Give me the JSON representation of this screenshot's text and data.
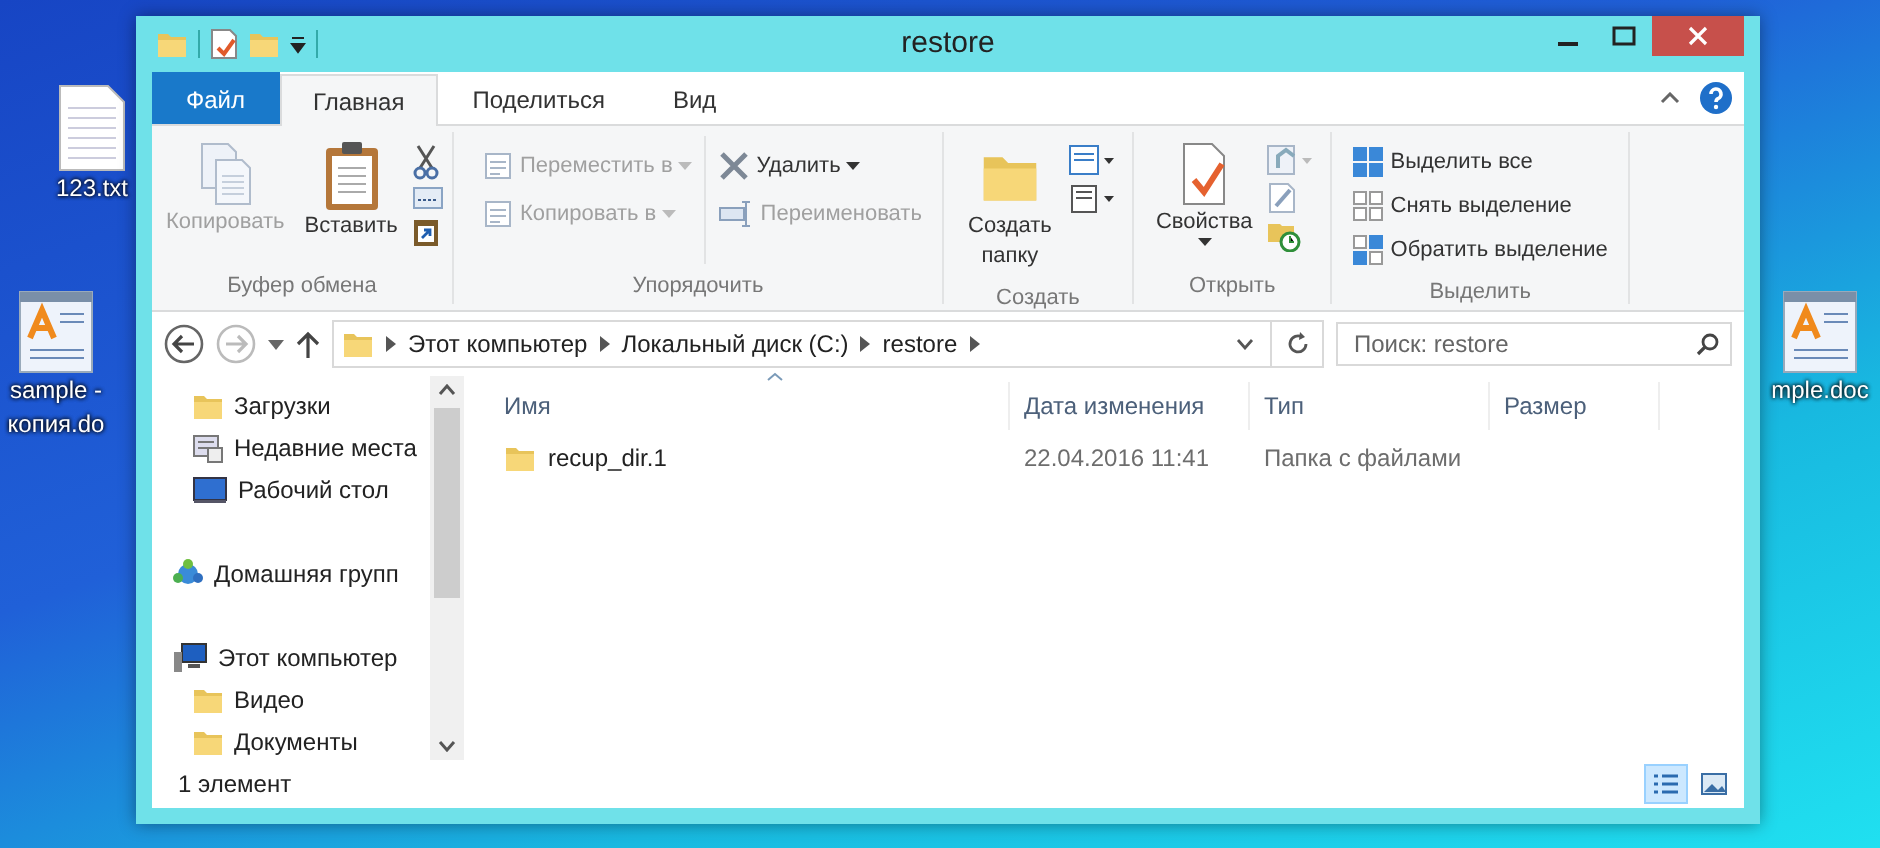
{
  "desktop_icons": [
    {
      "kind": "text",
      "label_lines": [
        "123.txt"
      ]
    },
    {
      "kind": "document",
      "label_lines": [
        "sample -",
        "копия.do"
      ]
    },
    {
      "kind": "document",
      "label_lines": [
        "mple.doc"
      ]
    }
  ],
  "window": {
    "title": "restore"
  },
  "tabs": [
    {
      "label": "Файл",
      "kind": "file",
      "selected": false
    },
    {
      "label": "Главная",
      "kind": "tab",
      "selected": true
    },
    {
      "label": "Поделиться",
      "kind": "tab",
      "selected": false
    },
    {
      "label": "Вид",
      "kind": "tab",
      "selected": false
    }
  ],
  "ribbon_groups": [
    {
      "label": "Буфер обмена",
      "buttons": [
        {
          "label": "Копировать",
          "disabled": true
        },
        {
          "label": "Вставить",
          "disabled": false
        }
      ]
    },
    {
      "label": "Упорядочить",
      "buttons": [
        {
          "label": "Переместить в",
          "disabled": true
        },
        {
          "label": "Копировать в",
          "disabled": true
        },
        {
          "label": "Удалить",
          "disabled": false
        },
        {
          "label": "Переименовать",
          "disabled": true
        }
      ]
    },
    {
      "label": "Создать",
      "buttons": [
        {
          "label": "Создать папку",
          "disabled": false
        }
      ]
    },
    {
      "label": "Открыть",
      "buttons": [
        {
          "label": "Свойства",
          "disabled": false
        }
      ]
    },
    {
      "label": "Выделить",
      "buttons": [
        {
          "label": "Выделить все",
          "disabled": false
        },
        {
          "label": "Снять выделение",
          "disabled": false
        },
        {
          "label": "Обратить выделение",
          "disabled": false
        }
      ]
    }
  ],
  "address_bar": {
    "crumbs": [
      "Этот компьютер",
      "Локальный диск (C:)",
      "restore"
    ],
    "forward_disabled": true
  },
  "search": {
    "placeholder": "Поиск: restore"
  },
  "nav_groups": [
    {
      "children": [
        {
          "label": "Загрузки"
        },
        {
          "label": "Недавние места"
        },
        {
          "label": "Рабочий стол"
        }
      ]
    },
    {
      "label": "Домашняя групп"
    },
    {
      "label": "Этот компьютер",
      "children": [
        {
          "label": "Видео"
        },
        {
          "label": "Документы"
        }
      ]
    }
  ],
  "table": {
    "columns": [
      "Имя",
      "Дата изменения",
      "Тип",
      "Размер"
    ],
    "rows": [
      {
        "name": "recup_dir.1",
        "date": "22.04.2016 11:41",
        "type": "Папка с файлами"
      }
    ]
  },
  "status_bar": {
    "text": "1 элемент",
    "views": [
      {
        "selected": true
      },
      {
        "selected": false
      }
    ]
  }
}
